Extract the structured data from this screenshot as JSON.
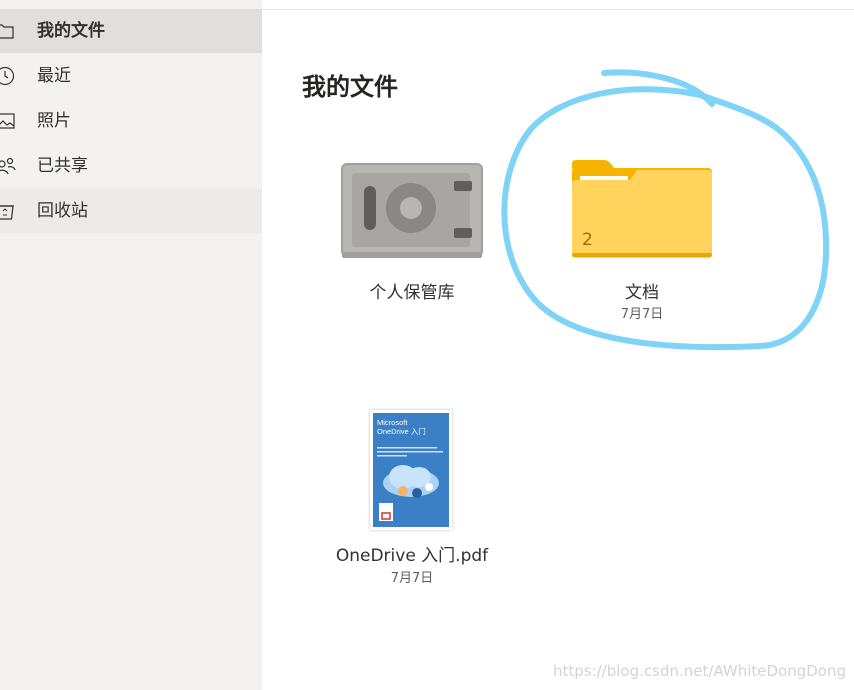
{
  "sidebar": {
    "items": [
      {
        "label": "我的文件",
        "icon": "folder-icon",
        "selected": true
      },
      {
        "label": "最近",
        "icon": "clock-icon",
        "selected": false
      },
      {
        "label": "照片",
        "icon": "image-icon",
        "selected": false
      },
      {
        "label": "已共享",
        "icon": "people-icon",
        "selected": false
      },
      {
        "label": "回收站",
        "icon": "recycle-bin-icon",
        "selected": false
      }
    ]
  },
  "main": {
    "title": "我的文件",
    "tiles": [
      {
        "name": "个人保管库",
        "icon": "vault-safe-icon"
      },
      {
        "name": "文档",
        "date": "7月7日",
        "count": "2",
        "icon": "folder-icon"
      },
      {
        "name": "OneDrive 入门.pdf",
        "date": "7月7日",
        "icon": "pdf-thumbnail",
        "thumbnail_title": "Microsoft\nOneDrive 入门"
      }
    ]
  },
  "colors": {
    "sidebar_bg": "#f3f2f1",
    "selected_bg": "#e1dfdd",
    "folder_yellow": "#ffd35c",
    "folder_tab": "#f4b400",
    "annotation_circle": "#7fd3f7",
    "pdf_cover_blue": "#3b7fc4"
  },
  "watermark": "https://blog.csdn.net/AWhiteDongDong"
}
